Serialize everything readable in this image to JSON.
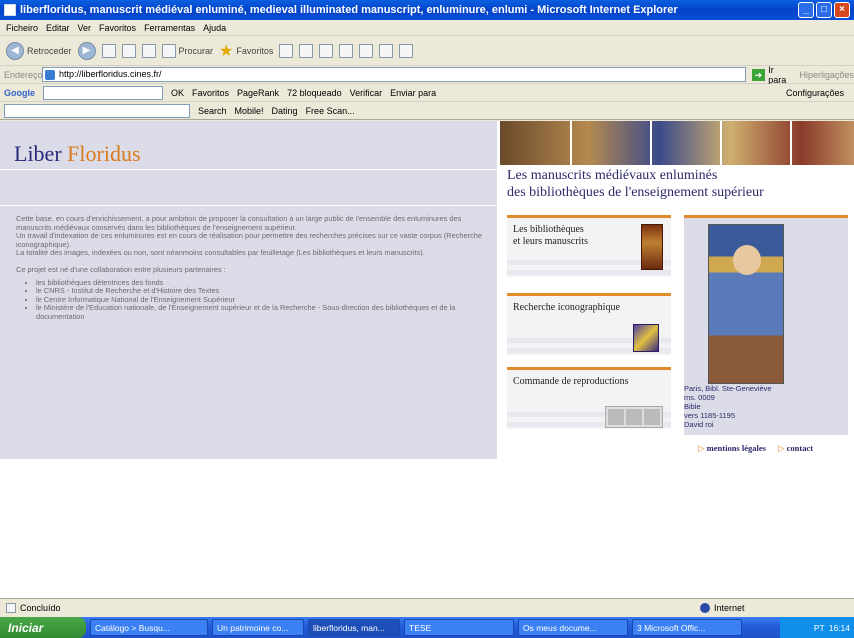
{
  "window": {
    "title": "liberfloridus, manuscrit médiéval enluminé, medieval illuminated manuscript, enluminure, enlumi - Microsoft Internet Explorer"
  },
  "menu": [
    "Ficheiro",
    "Editar",
    "Ver",
    "Favoritos",
    "Ferramentas",
    "Ajuda"
  ],
  "toolbar": {
    "back": "Retroceder",
    "search": "Procurar",
    "favorites": "Favoritos"
  },
  "address": {
    "label": "Endereço",
    "url": "http://liberfloridus.cines.fr/",
    "go": "Ir para",
    "links": "Hiperligações"
  },
  "google_bar": {
    "logo": "Google",
    "ok": "OK",
    "favoritos": "Favoritos",
    "pagerank": "PageRank",
    "blocked": "72 bloqueado",
    "verify": "Verificar",
    "send": "Enviar para",
    "settings": "Configurações"
  },
  "extra_bar": {
    "search": "Search",
    "mobile": "Mobile!",
    "dating": "Dating",
    "freescan": "Free Scan..."
  },
  "site": {
    "logo_a": "Liber",
    "logo_b": "Floridus",
    "headline_1": "Les manuscrits médiévaux enluminés",
    "headline_2": "des bibliothèques de l'enseignement supérieur",
    "intro_1": "Cette base, en cours d'enrichissement, a pour ambition de proposer la consultation à un large public de l'ensemble des enluminures des manuscrits médiévaux conservés dans les bibliothèques de l'enseignement supérieur.",
    "intro_2": "Un travail d'indexation de ces enluminures est en cours de réalisation pour permettre des recherches précises sur ce vaste corpus (Recherche iconographique).",
    "intro_3": "La totalité des images, indexées ou non, sont néanmoins consultables par feuilletage (Les bibliothèques et leurs manuscrits).",
    "partners_intro": "Ce projet est né d'une collaboration entre plusieurs partenaires :",
    "partners": [
      "les bibliothèques détentrices des fonds",
      "le CNRS - Institut de Recherche et d'Histoire des Textes",
      "le Centre Informatique National de l'Enseignement Supérieur",
      "le Ministère de l'Education nationale, de l'Enseignement supérieur et de la Recherche - Sous-direction des bibliothèques et de la documentation"
    ],
    "card1_line1": "Les bibliothèques",
    "card1_line2": "et leurs manuscrits",
    "card2": "Recherche iconographique",
    "card3": "Commande de reproductions",
    "caption": [
      "Paris, Bibl. Ste-Geneviève",
      "ms. 0009",
      "Bible",
      "vers 1185-1195",
      "David roi"
    ],
    "legal": "mentions légales",
    "contact": "contact"
  },
  "status": {
    "left": "Concluído",
    "zone": "Internet"
  },
  "taskbar": {
    "start": "Iniciar",
    "tasks": [
      "Catálogo > Busqu...",
      "Un patrimoine co...",
      "liberfloridus, man...",
      "TESE",
      "Os meus docume...",
      "3 Microsoft Offic..."
    ],
    "lang": "PT",
    "time": "16:14"
  }
}
